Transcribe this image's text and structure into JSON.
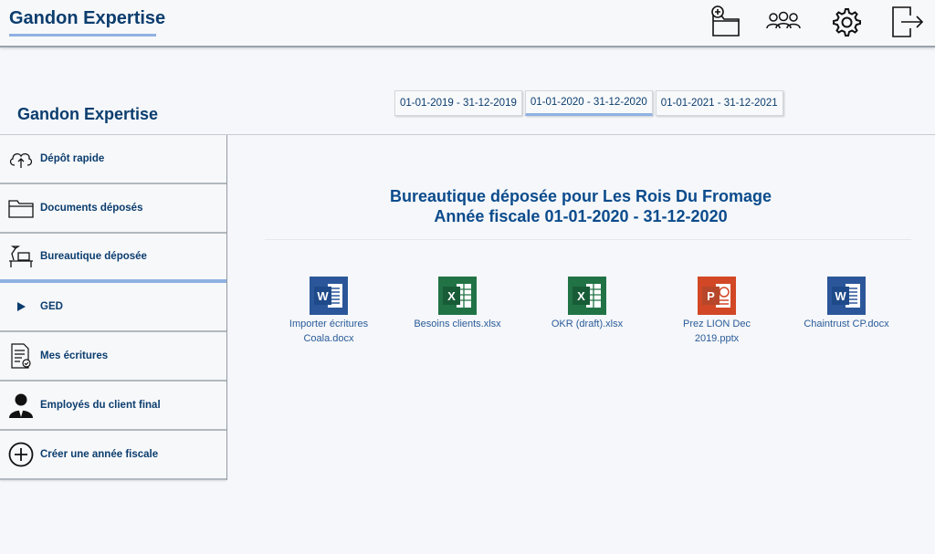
{
  "header": {
    "brand": "Gandon Expertise",
    "icons": [
      "folder-plus-icon",
      "users-icon",
      "gear-icon",
      "logout-icon"
    ]
  },
  "company": {
    "name": "Gandon Expertise"
  },
  "fiscal_years": [
    {
      "label": "01-01-2019 - 31-12-2019",
      "active": false
    },
    {
      "label": "01-01-2020 - 31-12-2020",
      "active": true
    },
    {
      "label": "01-01-2021 - 31-12-2021",
      "active": false
    }
  ],
  "sidebar": {
    "items": [
      {
        "label": "Dépôt rapide",
        "icon": "cloud-upload-icon"
      },
      {
        "label": "Documents déposés",
        "icon": "folder-icon"
      },
      {
        "label": "Bureautique déposée",
        "icon": "desk-icon",
        "active": true
      },
      {
        "label": "GED",
        "icon": "triangle-right-icon"
      },
      {
        "label": "Mes écritures",
        "icon": "document-check-icon"
      },
      {
        "label": "Employés du client final",
        "icon": "person-icon"
      },
      {
        "label": "Créer une année fiscale",
        "icon": "plus-circle-icon"
      }
    ]
  },
  "main": {
    "title_line1": "Bureautique déposée pour Les Rois Du Fromage",
    "title_line2": "Année fiscale 01-01-2020 - 31-12-2020"
  },
  "files": [
    {
      "line1": "Importer écritures",
      "line2": "Coala.docx",
      "type": "word",
      "color": "#2b579a",
      "letter": "W"
    },
    {
      "line1": "Besoins clients.xlsx",
      "line2": "",
      "type": "excel",
      "color": "#217346",
      "letter": "X"
    },
    {
      "line1": "OKR (draft).xlsx",
      "line2": "",
      "type": "excel",
      "color": "#217346",
      "letter": "X"
    },
    {
      "line1": "Prez LION Dec",
      "line2": "2019.pptx",
      "type": "powerpoint",
      "color": "#d24726",
      "letter": "P"
    },
    {
      "line1": "Chaintrust CP.docx",
      "line2": "",
      "type": "word",
      "color": "#2b579a",
      "letter": "W"
    }
  ]
}
